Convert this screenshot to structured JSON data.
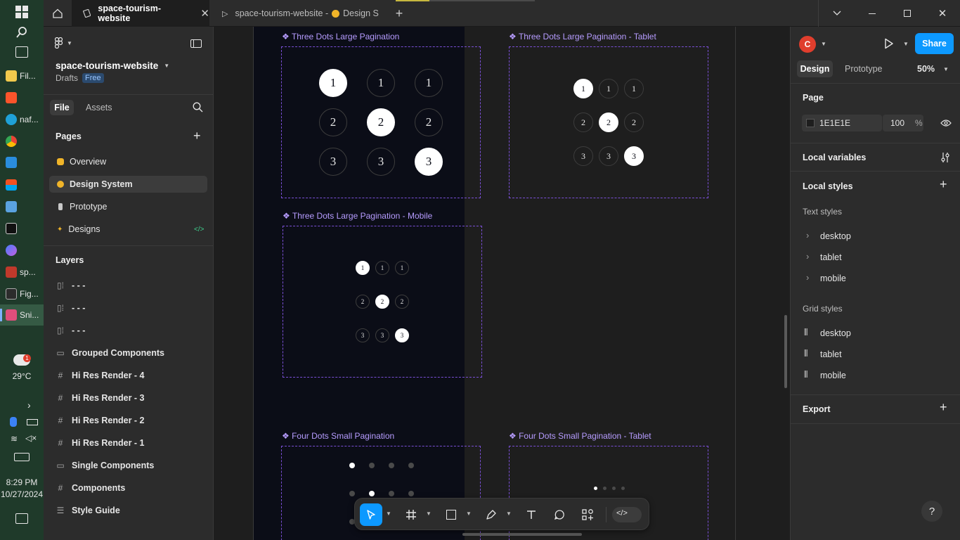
{
  "taskbar": {
    "items": [
      "Fil...",
      "naf...",
      "sp...",
      "Fig...",
      "Sni..."
    ],
    "weather_temp": "29°C",
    "weather_badge": "1",
    "time": "8:29 PM",
    "date": "10/27/2024"
  },
  "tabs": {
    "active_title": "space-tourism-website",
    "second_title": "space-tourism-website - ",
    "second_suffix": "Design S",
    "add": "+"
  },
  "left_panel": {
    "file_name": "space-tourism-website",
    "drafts": "Drafts",
    "plan_badge": "Free",
    "tab_file": "File",
    "tab_assets": "Assets",
    "pages_heading": "Pages",
    "pages": [
      {
        "label": "Overview",
        "icon": "hand-icon"
      },
      {
        "label": "Design System",
        "icon": "emoji-icon"
      },
      {
        "label": "Prototype",
        "icon": "phone-icon"
      },
      {
        "label": "Designs",
        "icon": "sparkle-icon"
      }
    ],
    "dev_mode_label": "</>",
    "layers_heading": "Layers",
    "layers": [
      {
        "label": "- - -",
        "icon": "auto-layout-icon"
      },
      {
        "label": "- - -",
        "icon": "auto-layout-icon"
      },
      {
        "label": "- - -",
        "icon": "auto-layout-icon"
      },
      {
        "label": "Grouped Components",
        "icon": "section-icon"
      },
      {
        "label": "Hi Res Render - 4",
        "icon": "frame-icon"
      },
      {
        "label": "Hi Res Render - 3",
        "icon": "frame-icon"
      },
      {
        "label": "Hi Res Render - 2",
        "icon": "frame-icon"
      },
      {
        "label": "Hi Res Render - 1",
        "icon": "frame-icon"
      },
      {
        "label": "Single Components",
        "icon": "section-icon"
      },
      {
        "label": "Components",
        "icon": "frame-icon"
      },
      {
        "label": "Style Guide",
        "icon": "text-icon"
      }
    ]
  },
  "canvas": {
    "frames": [
      {
        "title": "❖ Three Dots Large Pagination"
      },
      {
        "title": "❖ Three Dots Large Pagination - Tablet"
      },
      {
        "title": "❖ Three Dots Large Pagination - Mobile"
      },
      {
        "title": "❖ Four Dots Small Pagination"
      },
      {
        "title": "❖ Four Dots Small Pagination - Tablet"
      }
    ],
    "digits": [
      "1",
      "2",
      "3"
    ]
  },
  "right_panel": {
    "avatar_letter": "C",
    "share_label": "Share",
    "tab_design": "Design",
    "tab_prototype": "Prototype",
    "zoom": "50%",
    "page_heading": "Page",
    "page_color": "1E1E1E",
    "page_opacity": "100",
    "percent": "%",
    "local_variables": "Local variables",
    "local_styles": "Local styles",
    "text_styles_heading": "Text styles",
    "text_styles": [
      "desktop",
      "tablet",
      "mobile"
    ],
    "grid_styles_heading": "Grid styles",
    "grid_styles": [
      "desktop",
      "tablet",
      "mobile"
    ],
    "export_heading": "Export",
    "help": "?"
  },
  "colors": {
    "accent": "#0d99ff",
    "avatar": "#e03e2d",
    "frame_outline": "#7a4fd6",
    "canvas_bg": "#1e1e1e",
    "dark_frame": "#0b0d17"
  }
}
